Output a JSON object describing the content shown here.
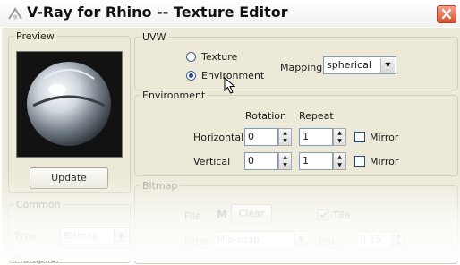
{
  "window": {
    "title": "V-Ray for Rhino -- Texture Editor"
  },
  "preview": {
    "legend": "Preview",
    "update_button": "Update"
  },
  "common": {
    "legend": "Common",
    "type_label": "Type",
    "type_value": "Bitmap",
    "multiplier_label": "Multiplier"
  },
  "uvw": {
    "legend": "UVW",
    "radio_texture": "Texture",
    "radio_environment": "Environment",
    "selected": "Environment",
    "mapping_label": "Mapping",
    "mapping_value": "spherical"
  },
  "environment": {
    "legend": "Environment",
    "col_rotation": "Rotation",
    "col_repeat": "Repeat",
    "rows": [
      {
        "label": "Horizontal",
        "rotation": "0",
        "repeat": "1",
        "mirror": "Mirror",
        "mirror_checked": false
      },
      {
        "label": "Vertical",
        "rotation": "0",
        "repeat": "1",
        "mirror": "Mirror",
        "mirror_checked": false
      }
    ]
  },
  "bitmap": {
    "legend": "Bitmap",
    "file_label": "File",
    "m_button": "M",
    "clear_button": "Clear",
    "tile_label": "Tile",
    "tile_checked": true,
    "filter_label": "Filter",
    "filter_value": "Mip-map",
    "blur_label": "Blur",
    "blur_value": "0.15"
  },
  "colors": {
    "panel_bg": "#ece9d8",
    "close_button": "#d9512e",
    "input_border": "#7f9db9"
  }
}
